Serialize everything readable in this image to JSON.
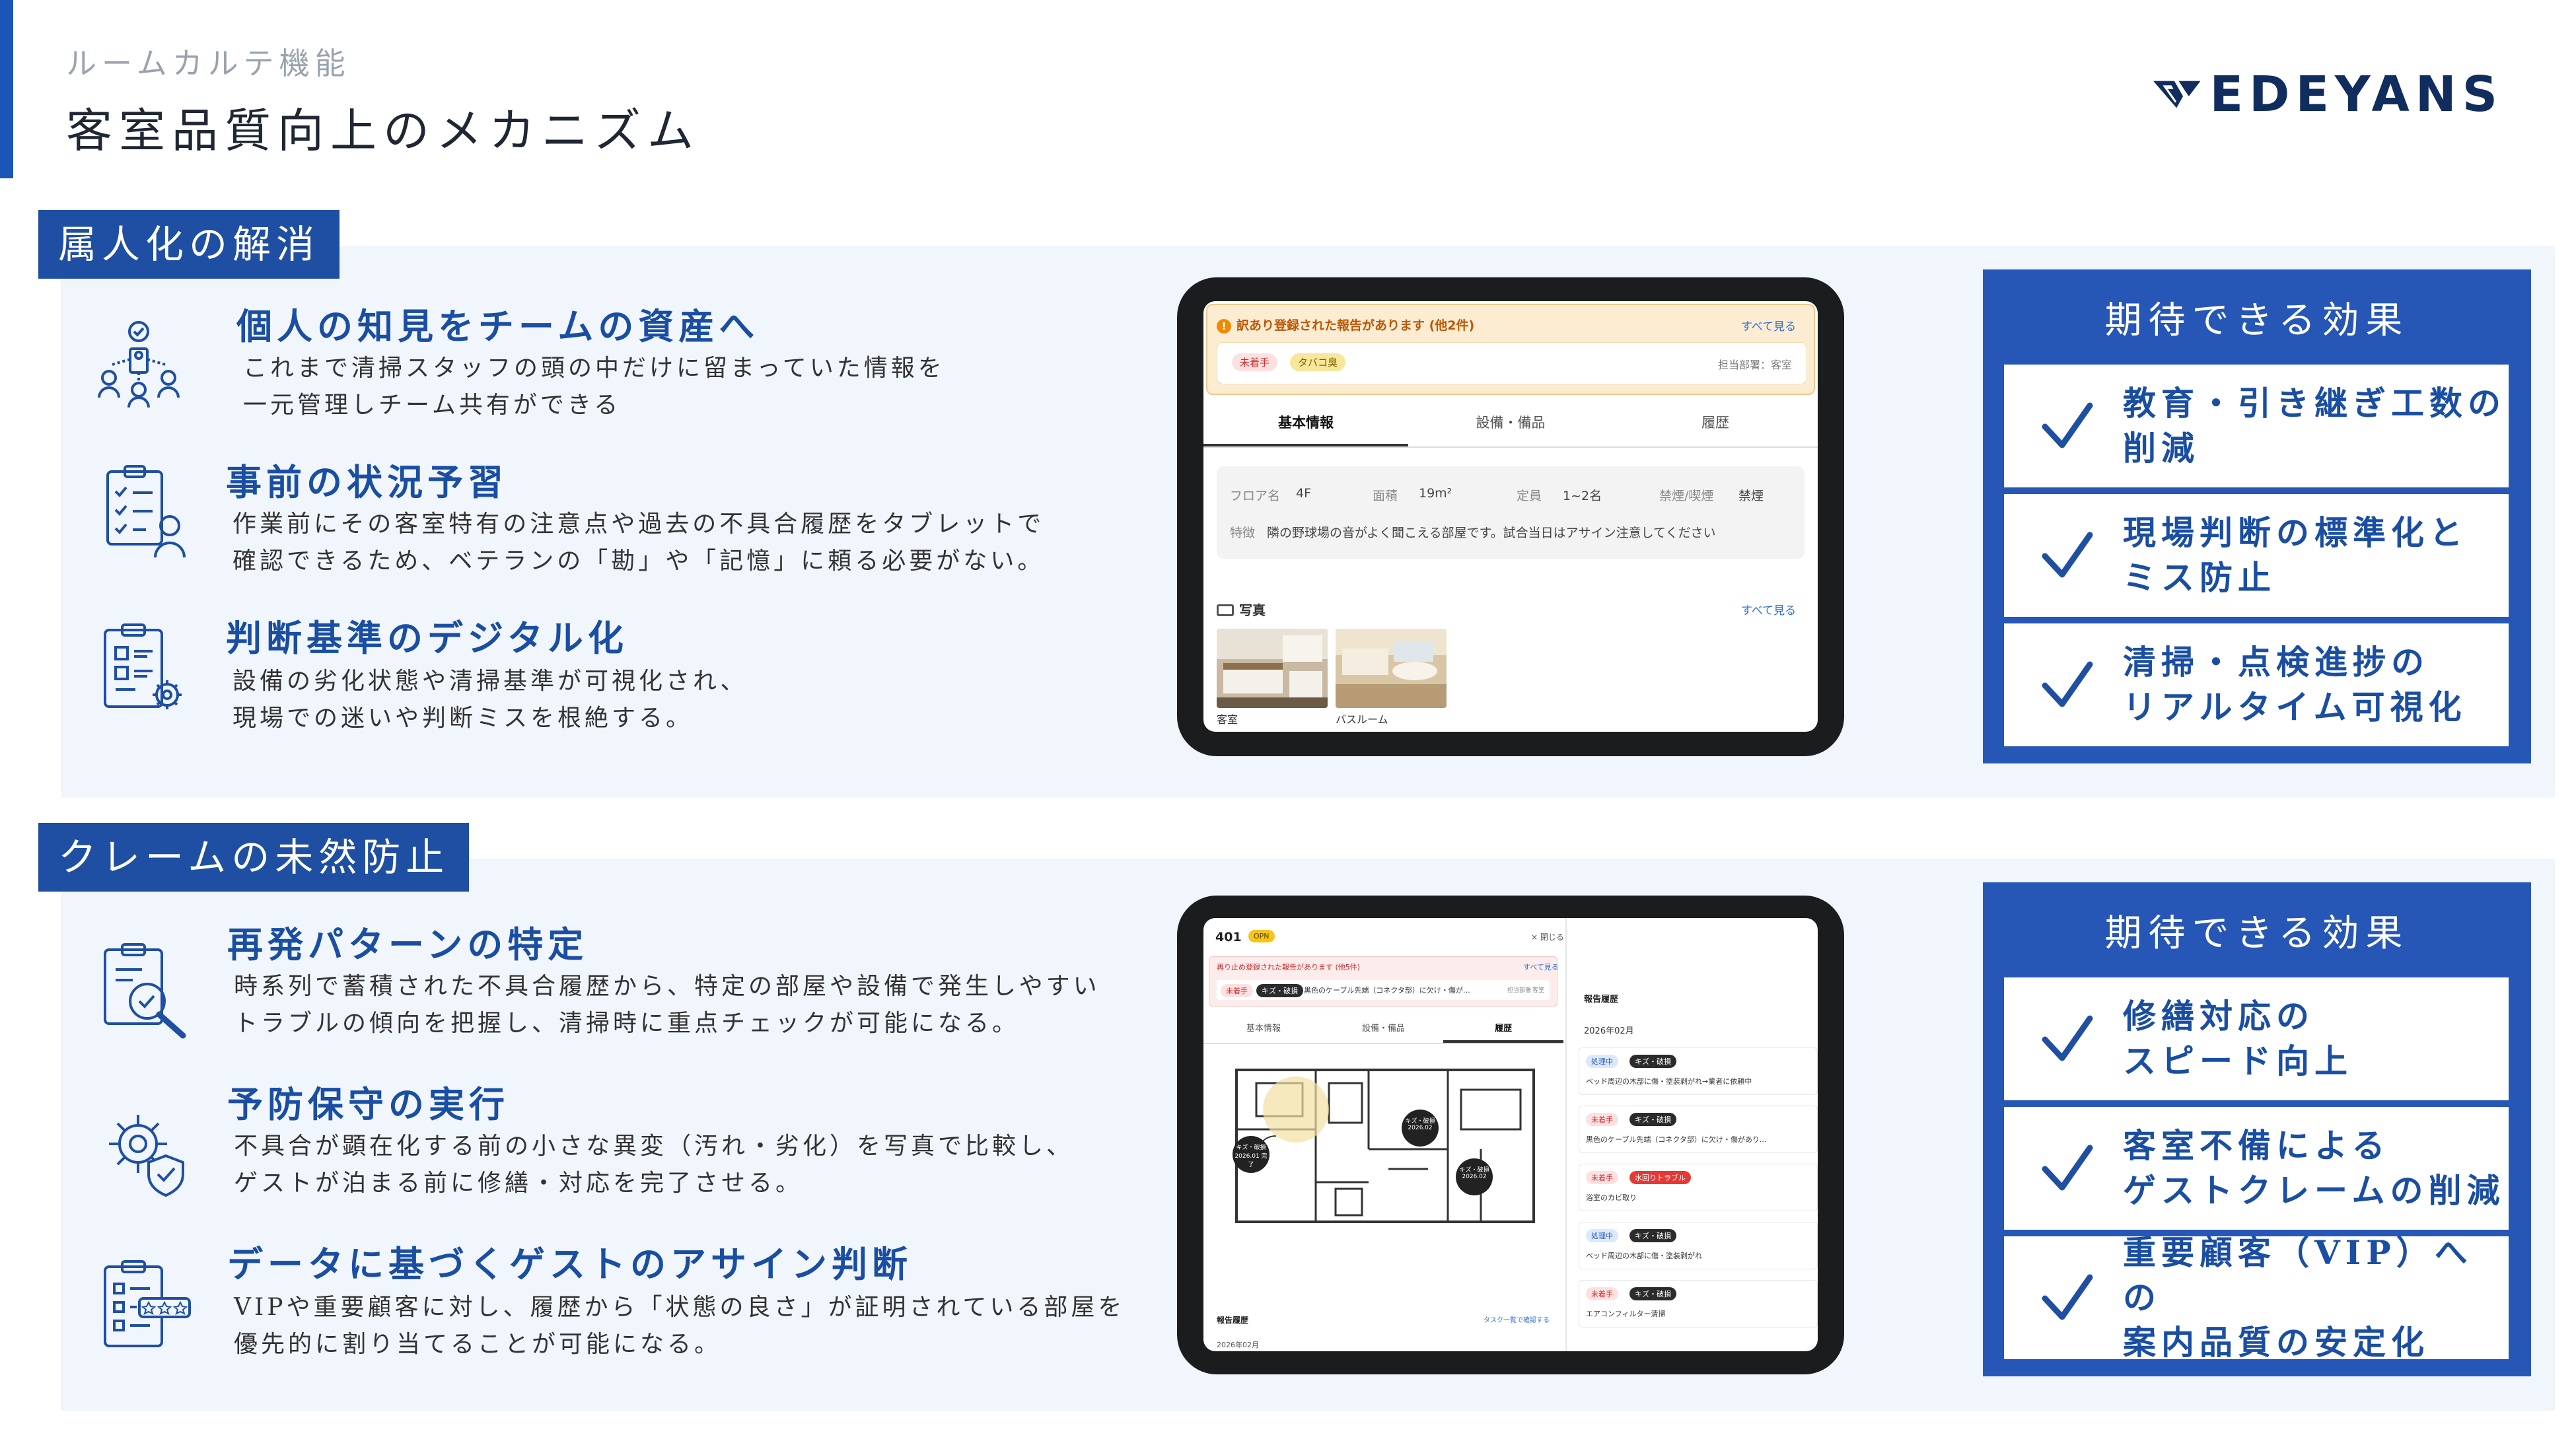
{
  "header": {
    "subtitle": "ルームカルテ機能",
    "title": "客室品質向上のメカニズム",
    "logo_text": "EDEYANS"
  },
  "colors": {
    "primary": "#1f4fa3",
    "panel": "#f1f6fc",
    "effect": "#2657b6"
  },
  "sections": [
    {
      "tag": "属人化の解消",
      "features": [
        {
          "icon": "team-knowledge-icon",
          "title": "個人の知見をチームの資産へ",
          "desc": [
            "これまで清掃スタッフの頭の中だけに留まっていた情報を",
            "一元管理しチーム共有ができる"
          ]
        },
        {
          "icon": "checklist-person-icon",
          "title": "事前の状況予習",
          "desc": [
            "作業前にその客室特有の注意点や過去の不具合履歴をタブレットで",
            "確認できるため、ベテランの「勘」や「記憶」に頼る必要がない。"
          ]
        },
        {
          "icon": "clipboard-gear-icon",
          "title": "判断基準のデジタル化",
          "desc": [
            "設備の劣化状態や清掃基準が可視化され、",
            "現場での迷いや判断ミスを根絶する。"
          ]
        }
      ],
      "effects": {
        "heading": "期待できる効果",
        "items": [
          [
            "教育・引き継ぎ工数の",
            "削減"
          ],
          [
            "現場判断の標準化と",
            "ミス防止"
          ],
          [
            "清掃・点検進捗の",
            "リアルタイム可視化"
          ]
        ]
      }
    },
    {
      "tag": "クレームの未然防止",
      "features": [
        {
          "icon": "magnifier-report-icon",
          "title": "再発パターンの特定",
          "desc": [
            "時系列で蓄積された不具合履歴から、特定の部屋や設備で発生しやすい",
            "トラブルの傾向を把握し、清掃時に重点チェックが可能になる。"
          ]
        },
        {
          "icon": "gear-shield-icon",
          "title": "予防保守の実行",
          "desc": [
            "不具合が顕在化する前の小さな異変（汚れ・劣化）を写真で比較し、",
            "ゲストが泊まる前に修繕・対応を完了させる。"
          ]
        },
        {
          "icon": "rating-checklist-icon",
          "title": "データに基づくゲストのアサイン判断",
          "desc": [
            "VIPや重要顧客に対し、履歴から「状態の良さ」が証明されている部屋を",
            "優先的に割り当てることが可能になる。"
          ]
        }
      ],
      "effects": {
        "heading": "期待できる効果",
        "items": [
          [
            "修繕対応の",
            "スピード向上"
          ],
          [
            "客室不備による",
            "ゲストクレームの削減"
          ],
          [
            "重要顧客（VIP）への",
            "案内品質の安定化"
          ]
        ]
      }
    }
  ],
  "tablet1": {
    "alert_title": "訳あり登録された報告があります (他2件)",
    "alert_link": "すべて見る",
    "chips": [
      "未着手",
      "タバコ臭"
    ],
    "dept": "担当部署：客室",
    "tabs": [
      "基本情報",
      "設備・備品",
      "履歴"
    ],
    "floor_label": "フロア名",
    "floor": "4F",
    "area_label": "面積",
    "area": "19m²",
    "cap_label": "定員",
    "cap": "1~2名",
    "smoke_label": "禁煙/喫煙",
    "smoke": "禁煙",
    "feature_label": "特徴",
    "feature": "隣の野球場の音がよく聞こえる部屋です。試合当日はアサイン注意してください",
    "photos_label": "写真",
    "photos_link": "すべて見る",
    "photo_captions": [
      "客室",
      "バスルーム"
    ]
  },
  "tablet2": {
    "room": "401",
    "status": "OPN",
    "close": "× 閉じる",
    "alert_title": "再り止め登録された報告があります (他5件)",
    "alert_link": "すべて見る",
    "alert_chips": [
      "未着手",
      "キズ・破損"
    ],
    "alert_text": "黒色のケーブル先端（コネクタ部）に欠け・傷が…",
    "alert_dept": "担当部署",
    "alert_room": "客室",
    "tabs": [
      "基本情報",
      "設備・備品",
      "履歴"
    ],
    "pin_labels": [
      "キズ・破損",
      "キズ・破損",
      "キズ・破損"
    ],
    "pin_dates": [
      "2026.01 完了",
      "2026.02",
      "2026.02"
    ],
    "report_title": "報告履歴",
    "report_link": "タスク一覧で確認する",
    "report_month": "2026年02月",
    "side_title": "報告履歴",
    "side_month": "2026年02月",
    "history": [
      {
        "status": "処理中",
        "tag": "キズ・破損",
        "text": "ベッド周辺の木部に傷・塗装剥がれ→業者に依頼中"
      },
      {
        "status": "未着手",
        "tag": "キズ・破損",
        "text": "黒色のケーブル先端（コネクタ部）に欠け・傷があり..."
      },
      {
        "status": "未着手",
        "tag": "水回りトラブル",
        "text": "浴室のカビ取り"
      },
      {
        "status": "処理中",
        "tag": "キズ・破損",
        "text": "ベッド周辺の木部に傷・塗装剥がれ"
      },
      {
        "status": "未着手",
        "tag": "キズ・破損",
        "text": "エアコンフィルター清掃"
      }
    ]
  }
}
